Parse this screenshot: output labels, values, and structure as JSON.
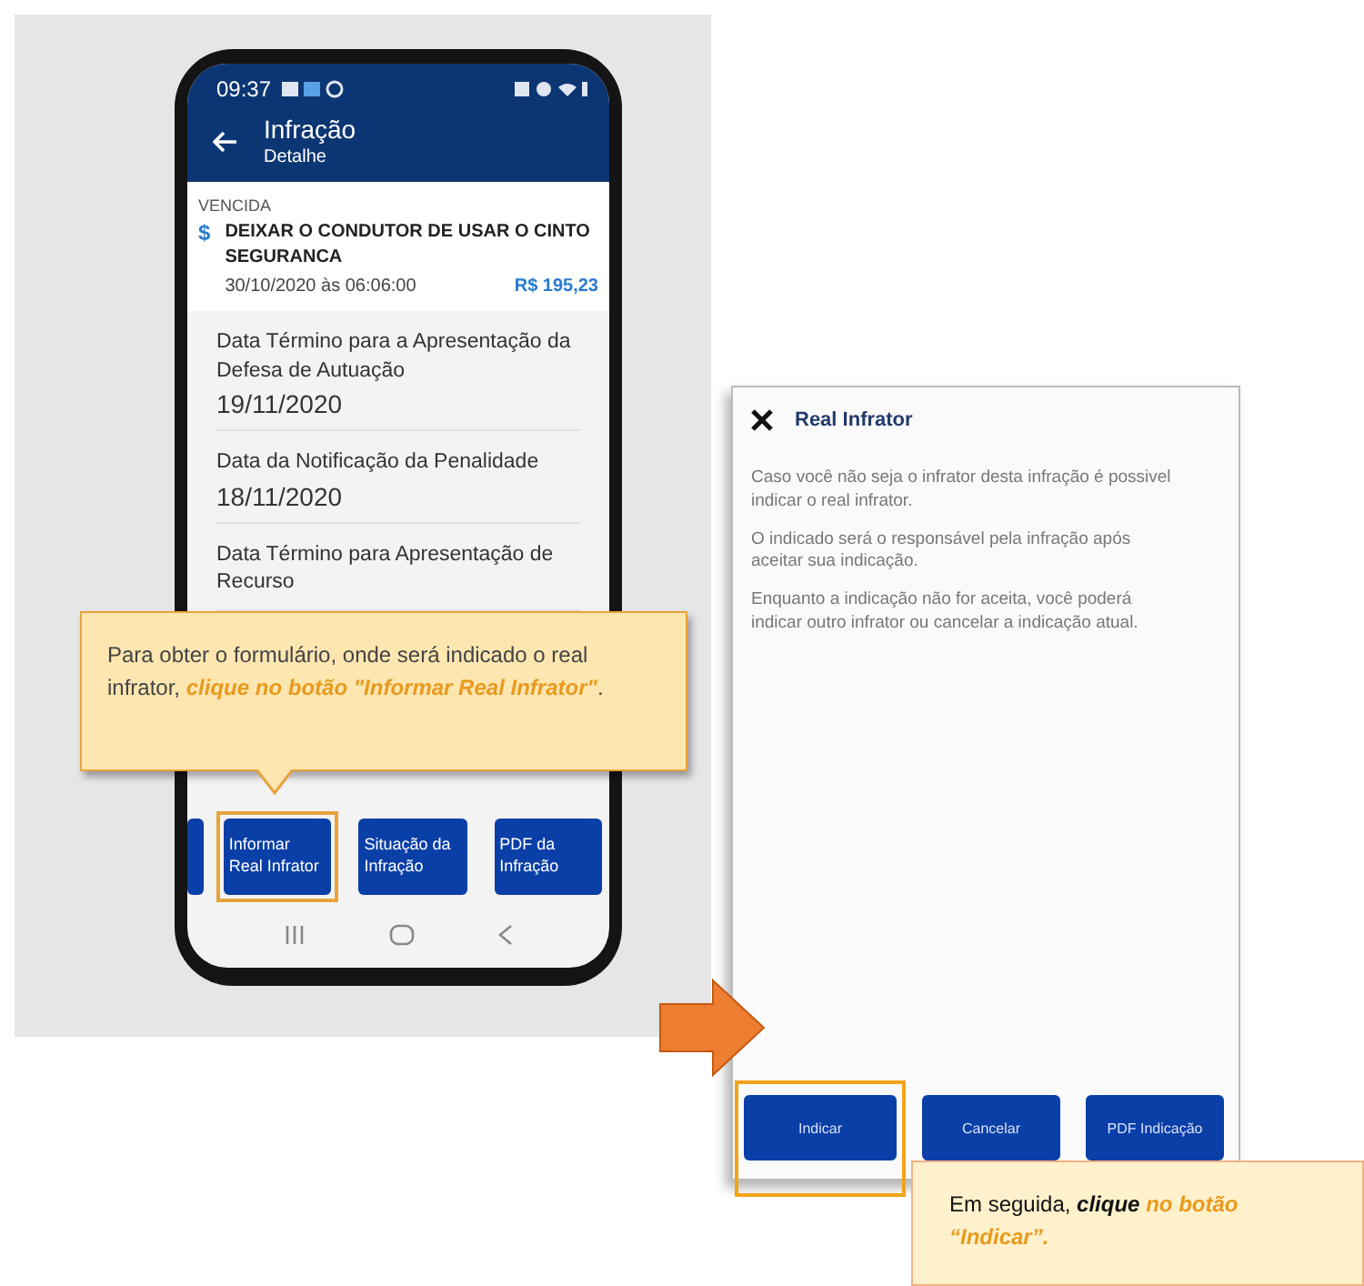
{
  "phone": {
    "status_time": "09:37",
    "app_bar": {
      "title": "Infração",
      "subtitle": "Detalhe"
    },
    "infraction": {
      "status": "VENCIDA",
      "currency_icon": "$",
      "description": "DEIXAR O CONDUTOR DE USAR O CINTO SEGURANCA",
      "datetime": "30/10/2020 às 06:06:00",
      "amount": "R$ 195,23"
    },
    "details": [
      {
        "label": "Data Término para a Apresentação da Defesa de Autuação",
        "value": "19/11/2020"
      },
      {
        "label": "Data da Notificação da Penalidade",
        "value": "18/11/2020"
      },
      {
        "label": "Data Término para Apresentação de Recurso"
      }
    ],
    "actions": [
      {
        "highlighted": false
      },
      {
        "label": "Informar Real Infrator",
        "highlighted": true
      },
      {
        "label": "Situação da Infração",
        "highlighted": false
      },
      {
        "label": "PDF da Infração",
        "highlighted": false
      }
    ]
  },
  "callout_1": [
    {
      "kind": "plain",
      "text": "Para obter o formulário, onde será indicado o real infrator, "
    },
    {
      "kind": "highlight",
      "text": "clique no botão \"Informar Real Infrator\""
    },
    {
      "kind": "plain",
      "text": "."
    }
  ],
  "modal": {
    "title": "Real Infrator",
    "paragraphs": [
      "Caso você não seja o infrator desta infração é possivel indicar o real infrator.",
      "O indicado será o responsável pela infração após aceitar sua indicação.",
      "Enquanto a indicação não for aceita, você poderá indicar outro infrator ou cancelar a indicação atual."
    ],
    "actions": [
      {
        "label": "Indicar",
        "highlighted": true
      },
      {
        "label": "Cancelar",
        "highlighted": false
      },
      {
        "label": "PDF Indicação",
        "highlighted": false
      }
    ]
  },
  "callout_2": [
    {
      "kind": "plain",
      "text": "Em seguida, "
    },
    {
      "kind": "emph",
      "text": "clique"
    },
    {
      "kind": "highlight",
      "text": " no botão “Indicar”."
    }
  ]
}
